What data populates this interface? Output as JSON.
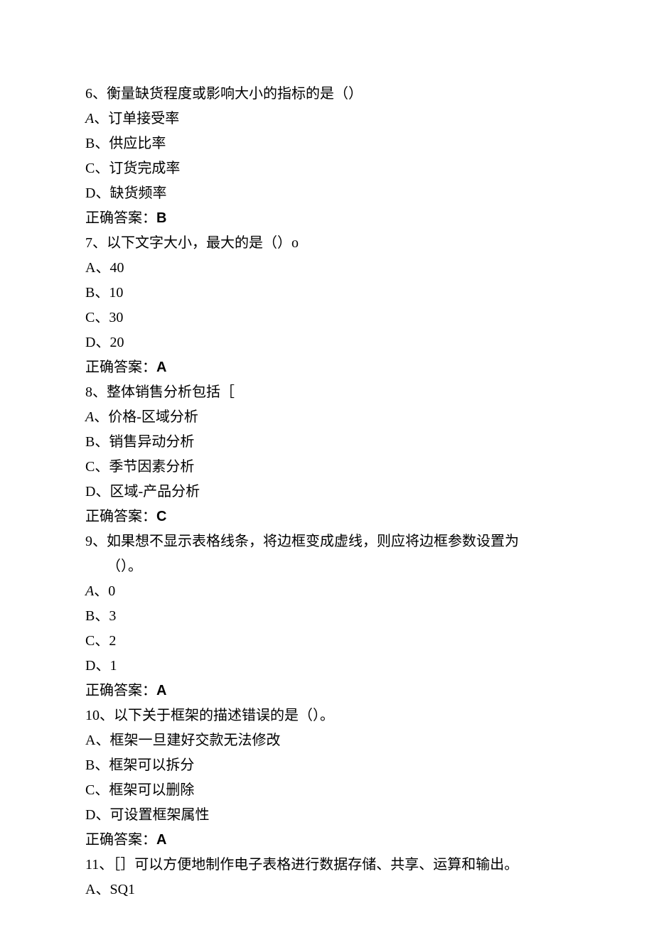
{
  "questions": [
    {
      "number": "6、",
      "stem": "衡量缺货程度或影响大小的指标的是（）",
      "options": [
        {
          "letter_italic": true,
          "letter": "A",
          "sep": "、",
          "text": "订单接受率"
        },
        {
          "letter_italic": false,
          "letter": "B",
          "sep": "、",
          "text": "供应比率"
        },
        {
          "letter_italic": false,
          "letter": "C",
          "sep": "、",
          "text": "订货完成率"
        },
        {
          "letter_italic": false,
          "letter": "D",
          "sep": "、",
          "text": "缺货频率"
        }
      ],
      "answer_label": "正确答案：",
      "answer": "B"
    },
    {
      "number": "7、",
      "stem": "以下文字大小，最大的是（）o",
      "options": [
        {
          "letter_italic": false,
          "letter": "A",
          "sep": "、",
          "text": "40"
        },
        {
          "letter_italic": false,
          "letter": "B",
          "sep": "、",
          "text": "10"
        },
        {
          "letter_italic": false,
          "letter": "C",
          "sep": "、",
          "text": "30"
        },
        {
          "letter_italic": false,
          "letter": "D",
          "sep": "、",
          "text": "20"
        }
      ],
      "answer_label": "正确答案：",
      "answer": "A"
    },
    {
      "number": "8、",
      "stem": "整体销售分析包括［",
      "options": [
        {
          "letter_italic": true,
          "letter": "A",
          "sep": "、",
          "text": "价格-区域分析"
        },
        {
          "letter_italic": false,
          "letter": "B",
          "sep": "、",
          "text": "销售异动分析"
        },
        {
          "letter_italic": false,
          "letter": "C",
          "sep": "、",
          "text": "季节因素分析"
        },
        {
          "letter_italic": false,
          "letter": "D",
          "sep": "、",
          "text": "区域-产品分析"
        }
      ],
      "answer_label": "正确答案：",
      "answer": "C"
    },
    {
      "number": "9、",
      "stem": "如果想不显示表格线条，将边框变成虚线，则应将边框参数设置为",
      "stem_line2": "（）。",
      "options": [
        {
          "letter_italic": true,
          "letter": "A",
          "sep": "、",
          "text": "0"
        },
        {
          "letter_italic": false,
          "letter": "B",
          "sep": "、",
          "text": "3"
        },
        {
          "letter_italic": false,
          "letter": "C",
          "sep": "、",
          "text": "2"
        },
        {
          "letter_italic": false,
          "letter": "D",
          "sep": "、",
          "text": "1"
        }
      ],
      "answer_label": "正确答案：",
      "answer": "A"
    },
    {
      "number": "10、",
      "stem": "以下关于框架的描述错误的是（）。",
      "options": [
        {
          "letter_italic": false,
          "letter": "A",
          "sep": "、",
          "text": "框架一旦建好交款无法修改"
        },
        {
          "letter_italic": false,
          "letter": "B",
          "sep": "、",
          "text": "框架可以拆分"
        },
        {
          "letter_italic": false,
          "letter": "C",
          "sep": "、",
          "text": "框架可以删除"
        },
        {
          "letter_italic": false,
          "letter": "D",
          "sep": "、",
          "text": "可设置框架属性"
        }
      ],
      "answer_label": "正确答案：",
      "answer": "A"
    },
    {
      "number": "11、",
      "stem": "［］可以方便地制作电子表格进行数据存储、共享、运算和输出。",
      "options": [
        {
          "letter_italic": false,
          "letter": "A",
          "sep": "、",
          "text": "SQ1"
        }
      ]
    }
  ]
}
